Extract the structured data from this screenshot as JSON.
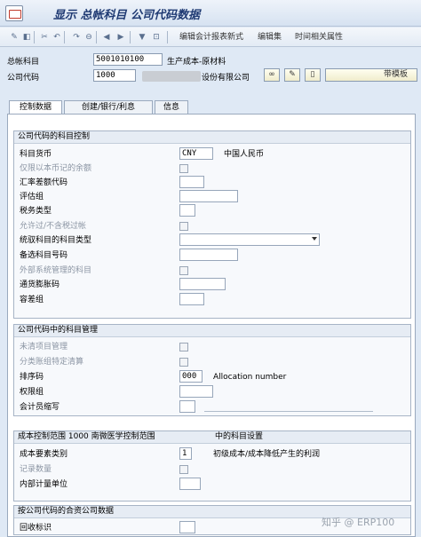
{
  "window": {
    "title": "显示 总帐科目 公司代码数据"
  },
  "toolbar": {
    "edit_cost_report": "编辑会计报表新式",
    "edit_set": "编辑集",
    "time_dependent": "时间相关属性"
  },
  "header": {
    "gl_account_label": "总帐科目",
    "gl_account_value": "5001010100",
    "gl_account_desc": "生产成本-原材料",
    "company_code_label": "公司代码",
    "company_code_value": "1000",
    "company_name_suffix": "设份有限公司",
    "template_button": "带模板"
  },
  "tabs": [
    {
      "label": "控制数据"
    },
    {
      "label": "创建/银行/利息"
    },
    {
      "label": "信息"
    }
  ],
  "group1": {
    "title": "公司代码的科目控制",
    "account_currency_label": "科目货币",
    "account_currency_value": "CNY",
    "account_currency_desc": "中国人民币",
    "local_only_label": "仅限以本币记的余额",
    "exchange_diff_label": "汇率差额代码",
    "valuation_group_label": "评估组",
    "tax_category_label": "税务类型",
    "no_tax_label": "允许过/不含税过帐",
    "recon_label": "统驭科目的科目类型",
    "alt_account_label": "备选科目号码",
    "external_mgmt_label": "外部系统管理的科目",
    "inflation_label": "通货膨胀码",
    "tolerance_label": "容差组"
  },
  "group2": {
    "title": "公司代码中的科目管理",
    "open_item_label": "未清项目管理",
    "line_item_label": "分类账组特定清算",
    "sort_key_label": "排序码",
    "sort_key_value": "000",
    "sort_key_desc": "Allocation number",
    "auth_group_label": "权限组",
    "clerk_label": "会计员缩写"
  },
  "group3": {
    "title_left": "成本控制范围 1000 南微医学控制范围",
    "title_right": "中的科目设置",
    "cost_elem_cat_label": "成本要素类别",
    "cost_elem_cat_value": "1",
    "cost_elem_cat_desc": "初级成本/成本降低产生的利润",
    "record_qty_label": "记录数量",
    "internal_uom_label": "内部计量单位"
  },
  "group4": {
    "title": "按公司代码的合资公司数据",
    "recovery_label": "回收标识"
  },
  "watermark": "知乎 @ ERP100"
}
